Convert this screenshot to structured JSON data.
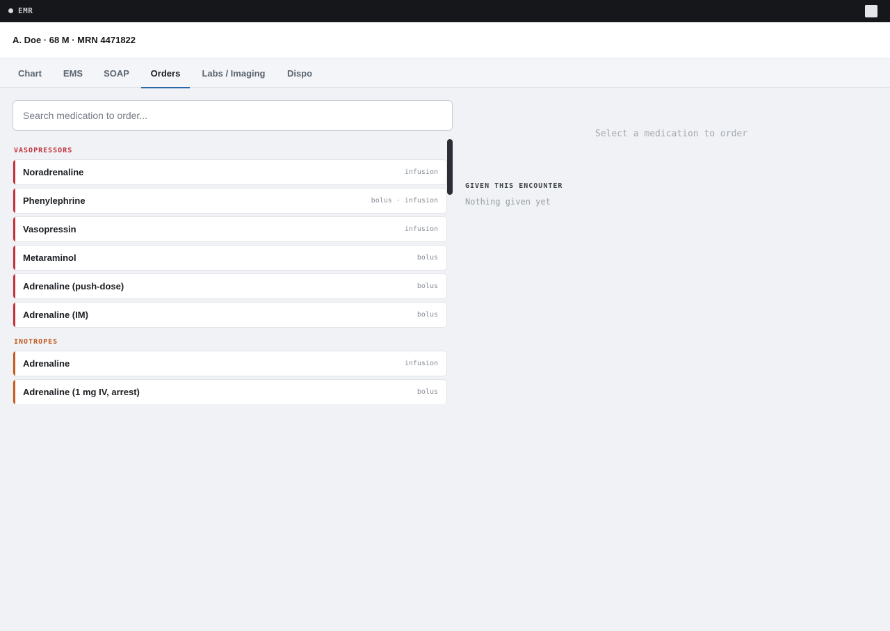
{
  "app": {
    "title": "EMR",
    "dot_icon": "status-dot-icon",
    "window_icon": "square-icon"
  },
  "patient": {
    "summary": "A. Doe · 68 M · MRN 4471822"
  },
  "tabs": [
    {
      "label": "Chart",
      "active": false
    },
    {
      "label": "EMS",
      "active": false
    },
    {
      "label": "SOAP",
      "active": false
    },
    {
      "label": "Orders",
      "active": true
    },
    {
      "label": "Labs / Imaging",
      "active": false
    },
    {
      "label": "Dispo",
      "active": false
    }
  ],
  "search": {
    "value": "",
    "placeholder": "Search medication to order..."
  },
  "colors": {
    "vasopressors": "#c4313b",
    "inotropes": "#c45a1e",
    "tab_underline": "#2a67a8"
  },
  "sections": [
    {
      "label": "VASOPRESSORS",
      "items": [
        {
          "name": "Noradrenaline",
          "route": "infusion"
        },
        {
          "name": "Phenylephrine",
          "route": "bolus · infusion"
        },
        {
          "name": "Vasopressin",
          "route": "infusion"
        },
        {
          "name": "Metaraminol",
          "route": "bolus"
        },
        {
          "name": "Adrenaline (push-dose)",
          "route": "bolus"
        },
        {
          "name": "Adrenaline (IM)",
          "route": "bolus"
        }
      ]
    },
    {
      "label": "INOTROPES",
      "items": [
        {
          "name": "Adrenaline",
          "route": "infusion"
        },
        {
          "name": "Adrenaline (1 mg IV, arrest)",
          "route": "bolus"
        }
      ]
    }
  ],
  "detail": {
    "hint": "Select a medication to order"
  },
  "given": {
    "heading": "GIVEN THIS ENCOUNTER",
    "empty": "Nothing given yet"
  }
}
